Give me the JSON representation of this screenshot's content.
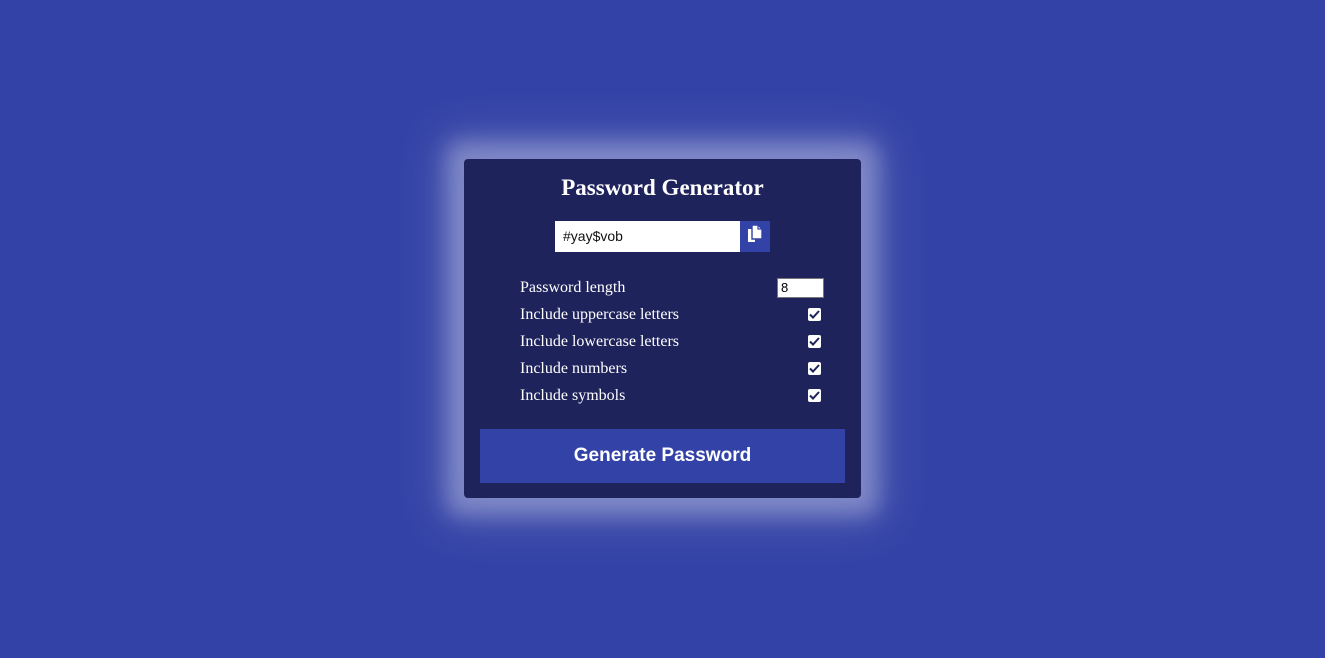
{
  "app": {
    "title": "Password Generator"
  },
  "result": {
    "value": "#yay$vob",
    "copy_icon": "clipboard-copy-icon"
  },
  "settings": {
    "length": {
      "label": "Password length",
      "value": "8"
    },
    "uppercase": {
      "label": "Include uppercase letters",
      "checked": true
    },
    "lowercase": {
      "label": "Include lowercase letters",
      "checked": true
    },
    "numbers": {
      "label": "Include numbers",
      "checked": true
    },
    "symbols": {
      "label": "Include symbols",
      "checked": true
    }
  },
  "generate": {
    "label": "Generate Password"
  },
  "colors": {
    "background": "#3342a6",
    "card": "#1f235c",
    "accent": "#3342a6",
    "text": "#ffffff"
  }
}
